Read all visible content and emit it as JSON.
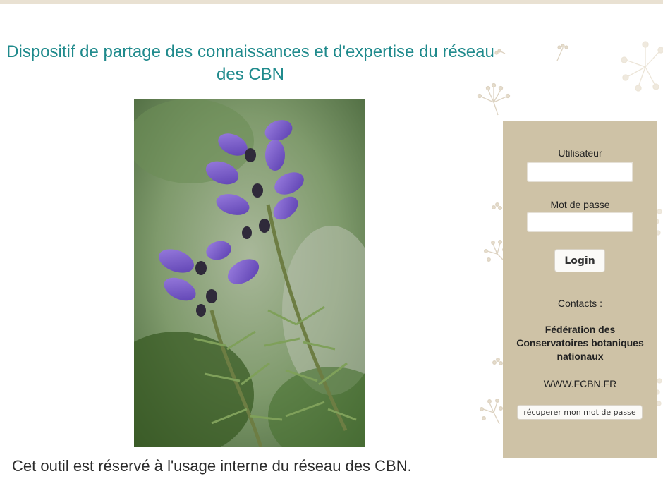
{
  "header": {
    "title": "Dispositif de partage des connaissances et d'expertise du réseau des CBN"
  },
  "photo": {
    "icon": "lavender-flower-photo"
  },
  "footer": {
    "note": "Cet outil est réservé à l'usage interne du réseau des CBN."
  },
  "login": {
    "user_label": "Utilisateur",
    "user_value": "",
    "password_label": "Mot de passe",
    "password_value": "",
    "login_button": "Login",
    "contacts_label": "Contacts :",
    "org_line1": "Fédération des",
    "org_line2": "Conservatoires botaniques",
    "org_line3": "nationaux",
    "website": "WWW.FCBN.FR",
    "reset_button": "récuperer mon mot de passe"
  },
  "colors": {
    "title": "#1f8a8c",
    "panel": "#cec2a6",
    "band": "#e9e1d2"
  }
}
